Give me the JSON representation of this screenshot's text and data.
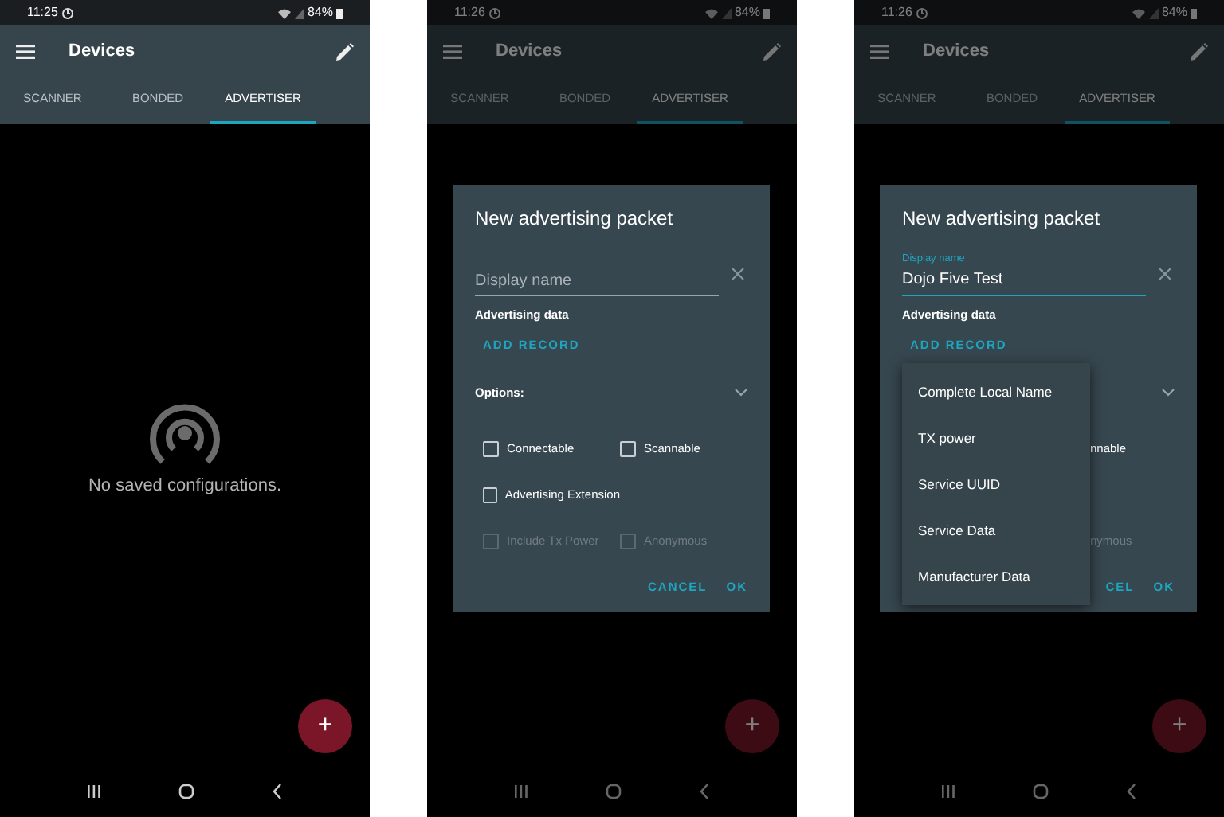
{
  "phones": [
    {
      "status_bar": {
        "time": "11:25",
        "battery": "84%"
      },
      "app_bar": {
        "title": "Devices"
      },
      "tabs": [
        {
          "label": "SCANNER",
          "selected": false
        },
        {
          "label": "BONDED",
          "selected": false
        },
        {
          "label": "ADVERTISER",
          "selected": true
        }
      ],
      "empty_state": {
        "message": "No saved configurations."
      },
      "fab": "+"
    },
    {
      "status_bar": {
        "time": "11:26",
        "battery": "84%"
      },
      "app_bar": {
        "title": "Devices"
      },
      "tabs": [
        {
          "label": "SCANNER",
          "selected": false
        },
        {
          "label": "BONDED",
          "selected": false
        },
        {
          "label": "ADVERTISER",
          "selected": true
        }
      ],
      "fab": "+",
      "dialog": {
        "title": "New advertising packet",
        "field": {
          "placeholder": "Display name"
        },
        "section": "Advertising data",
        "add_button": "ADD RECORD",
        "options": {
          "label": "Options:",
          "expanded": true,
          "rows": [
            [
              {
                "label": "Connectable",
                "checked": false,
                "disabled": false
              },
              {
                "label": "Scannable",
                "checked": false,
                "disabled": false
              }
            ],
            [
              {
                "label": "Advertising Extension",
                "checked": false,
                "disabled": false
              }
            ],
            [
              {
                "label": "Include Tx Power",
                "checked": false,
                "disabled": true
              },
              {
                "label": "Anonymous",
                "checked": false,
                "disabled": true
              }
            ]
          ]
        },
        "buttons": [
          "CANCEL",
          "OK"
        ]
      }
    },
    {
      "status_bar": {
        "time": "11:26",
        "battery": "84%"
      },
      "app_bar": {
        "title": "Devices"
      },
      "tabs": [
        {
          "label": "SCANNER",
          "selected": false
        },
        {
          "label": "BONDED",
          "selected": false
        },
        {
          "label": "ADVERTISER",
          "selected": true
        }
      ],
      "fab": "+",
      "dialog": {
        "title": "New advertising packet",
        "field": {
          "label": "Display name",
          "value": "Dojo Five Test"
        },
        "section": "Advertising data",
        "add_button": "ADD RECORD",
        "options": {
          "expanded": true,
          "fragments": [
            {
              "label": "nnable",
              "disabled": false
            },
            {
              "label": "nymous",
              "disabled": true
            }
          ]
        },
        "buttons": [
          "CEL",
          "OK"
        ],
        "menu": [
          "Complete Local Name",
          "TX power",
          "Service UUID",
          "Service Data",
          "Manufacturer Data"
        ]
      }
    }
  ]
}
